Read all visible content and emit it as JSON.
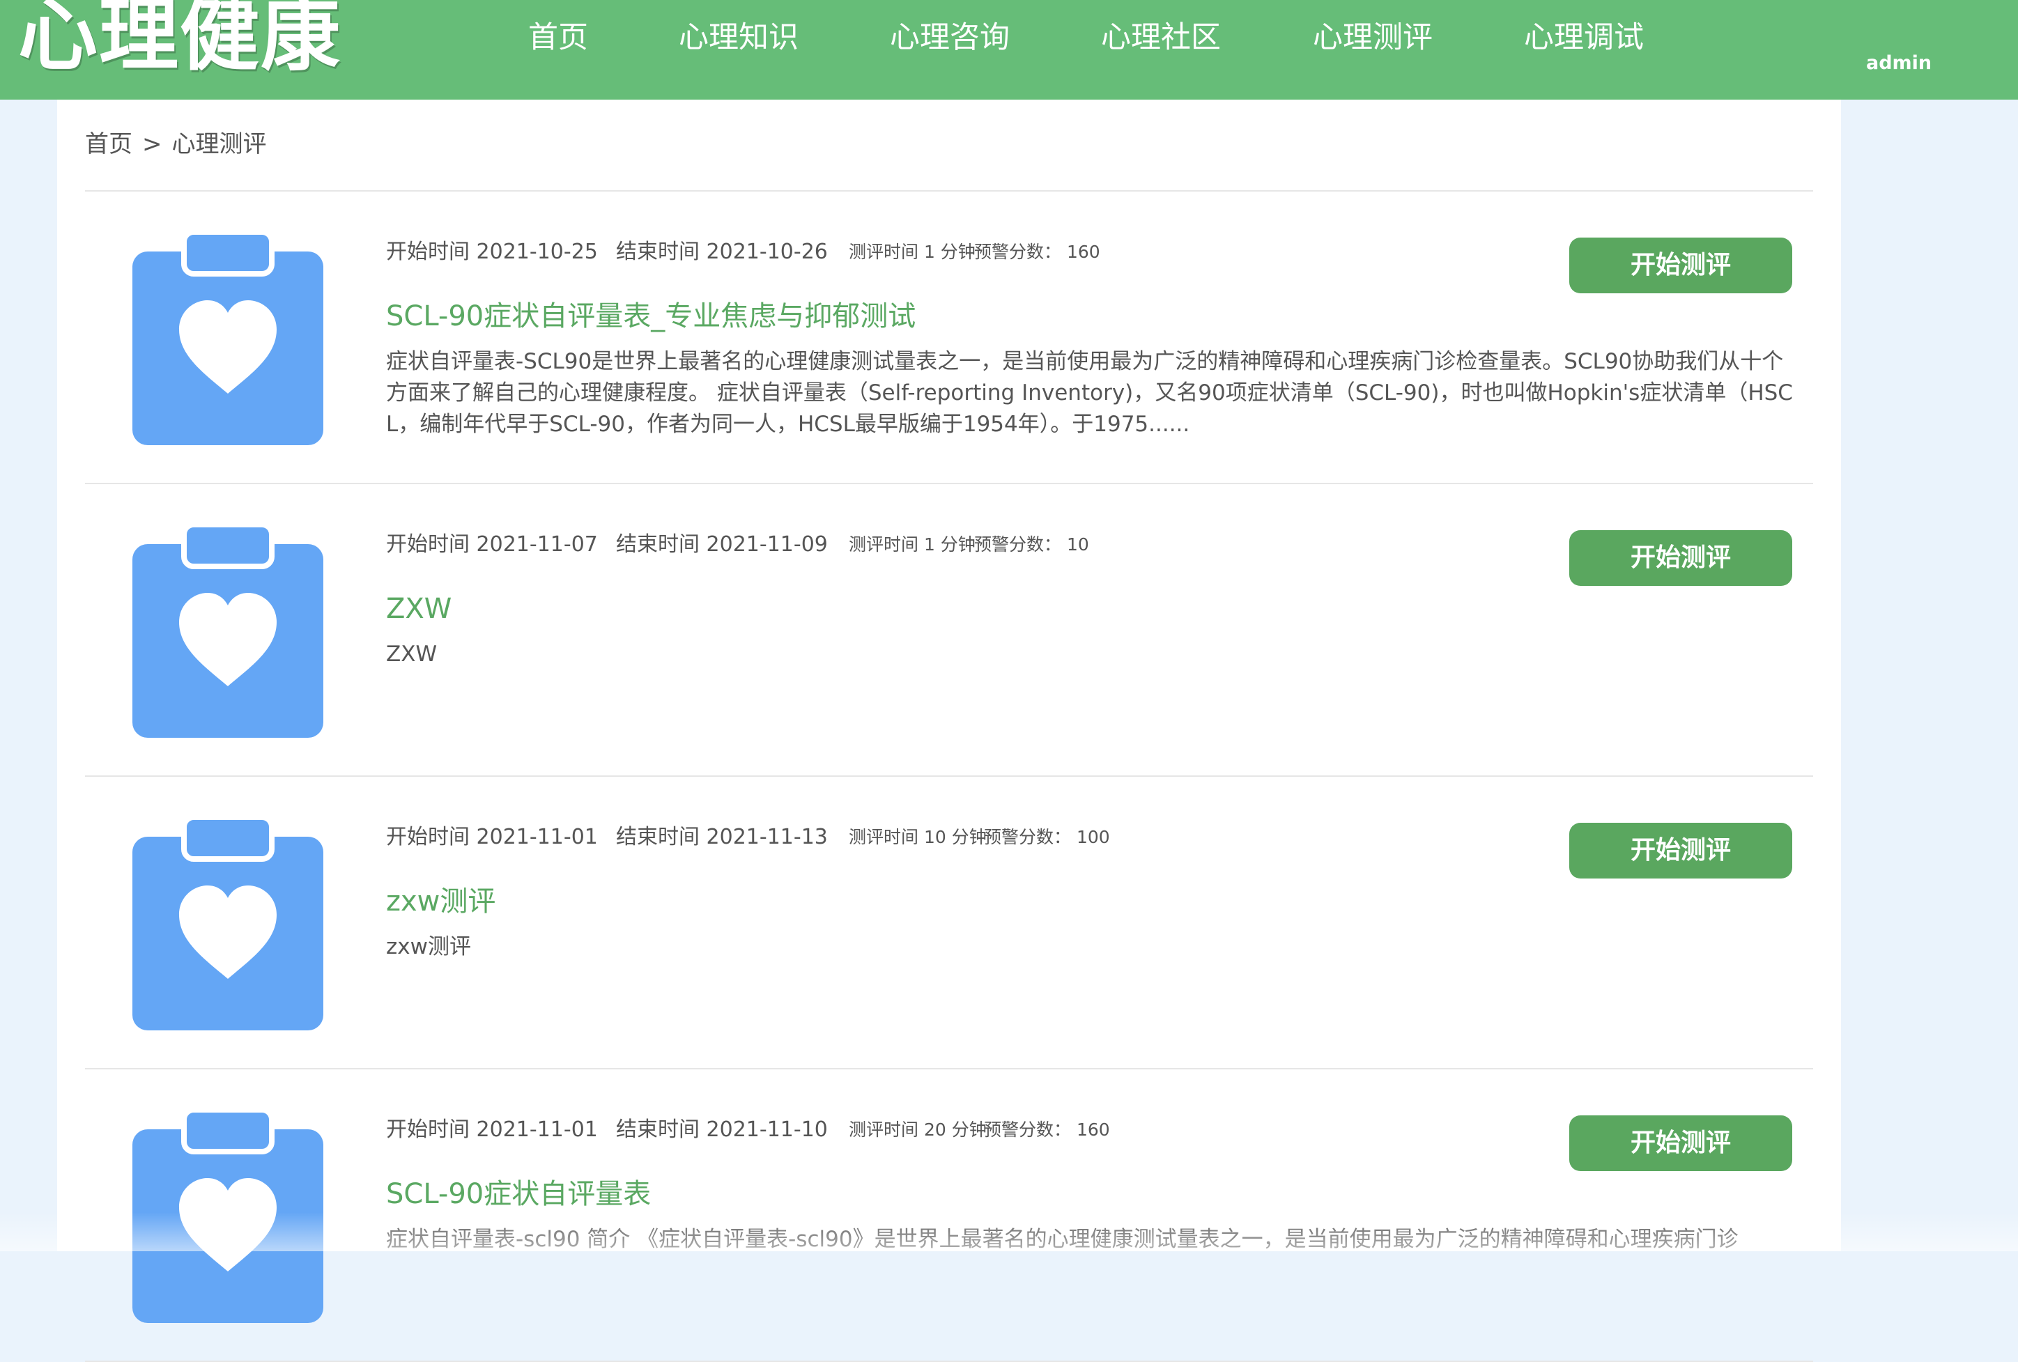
{
  "header": {
    "logo": "心理健康",
    "nav": [
      {
        "label": "首页"
      },
      {
        "label": "心理知识"
      },
      {
        "label": "心理咨询"
      },
      {
        "label": "心理社区"
      },
      {
        "label": "心理测评"
      },
      {
        "label": "心理调试"
      }
    ],
    "user": "admin"
  },
  "breadcrumb": {
    "home": "首页",
    "separator": ">",
    "current": "心理测评"
  },
  "colors": {
    "header_bg": "#66bd78",
    "page_bg": "#eaf3fc",
    "accent_green": "#5aa862",
    "button_bg": "#5aa75f",
    "icon_blue": "#64a6f5"
  },
  "icons": {
    "assessment_thumbnail": "clipboard-heart-icon"
  },
  "assessments": [
    {
      "start": "开始时间 2021-10-25",
      "end": "结束时间 2021-10-26",
      "duration": "测评时间 1 分钟",
      "warning": "预警分数： 160",
      "title": "SCL-90症状自评量表_专业焦虑与抑郁测试",
      "description": "症状自评量表-SCL90是世界上最著名的心理健康测试量表之一，是当前使用最为广泛的精神障碍和心理疾病门诊检查量表。SCL90协助我们从十个方面来了解自己的心理健康程度。 症状自评量表（Self-reporting Inventory)，又名90项症状清单（SCL-90)，时也叫做Hopkin's症状清单（HSCL，编制年代早于SCL-90，作者为同一人，HCSL最早版编于1954年）。于1975......",
      "button": "开始测评"
    },
    {
      "start": "开始时间 2021-11-07",
      "end": "结束时间 2021-11-09",
      "duration": "测评时间 1 分钟",
      "warning": "预警分数： 10",
      "title": "ZXW",
      "description": "ZXW",
      "button": "开始测评"
    },
    {
      "start": "开始时间 2021-11-01",
      "end": "结束时间 2021-11-13",
      "duration": "测评时间 10 分钟",
      "warning": "预警分数： 100",
      "title": "zxw测评",
      "description": "zxw测评",
      "button": "开始测评"
    },
    {
      "start": "开始时间 2021-11-01",
      "end": "结束时间 2021-11-10",
      "duration": "测评时间 20 分钟",
      "warning": "预警分数： 160",
      "title": "SCL-90症状自评量表",
      "description": "症状自评量表-scl90 简介 《症状自评量表-scl90》是世界上最著名的心理健康测试量表之一，是当前使用最为广泛的精神障碍和心理疾病门诊",
      "button": "开始测评"
    }
  ]
}
